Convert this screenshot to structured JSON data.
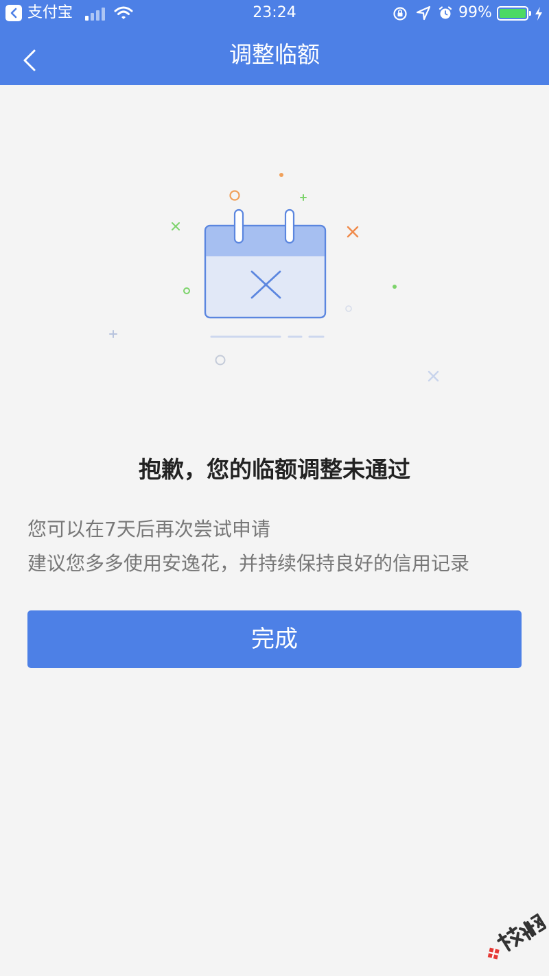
{
  "status_bar": {
    "back_app": "支付宝",
    "time": "23:24",
    "battery_percent": "99%",
    "battery_level": 0.99,
    "signal_bars": 4
  },
  "nav": {
    "title": "调整临额",
    "back_icon": "chevron-left-icon"
  },
  "illustration": {
    "icon": "calendar-rejected-icon"
  },
  "result": {
    "headline": "抱歉，您的临额调整未通过",
    "line1": "您可以在7天后再次尝试申请",
    "line2": "建议您多多使用安逸花，并持续保持良好的信用记录"
  },
  "actions": {
    "done_label": "完成"
  },
  "watermark": {
    "text": "卡农社区"
  },
  "colors": {
    "primary": "#4d80e6",
    "background": "#f4f4f4",
    "battery": "#4cd964"
  }
}
